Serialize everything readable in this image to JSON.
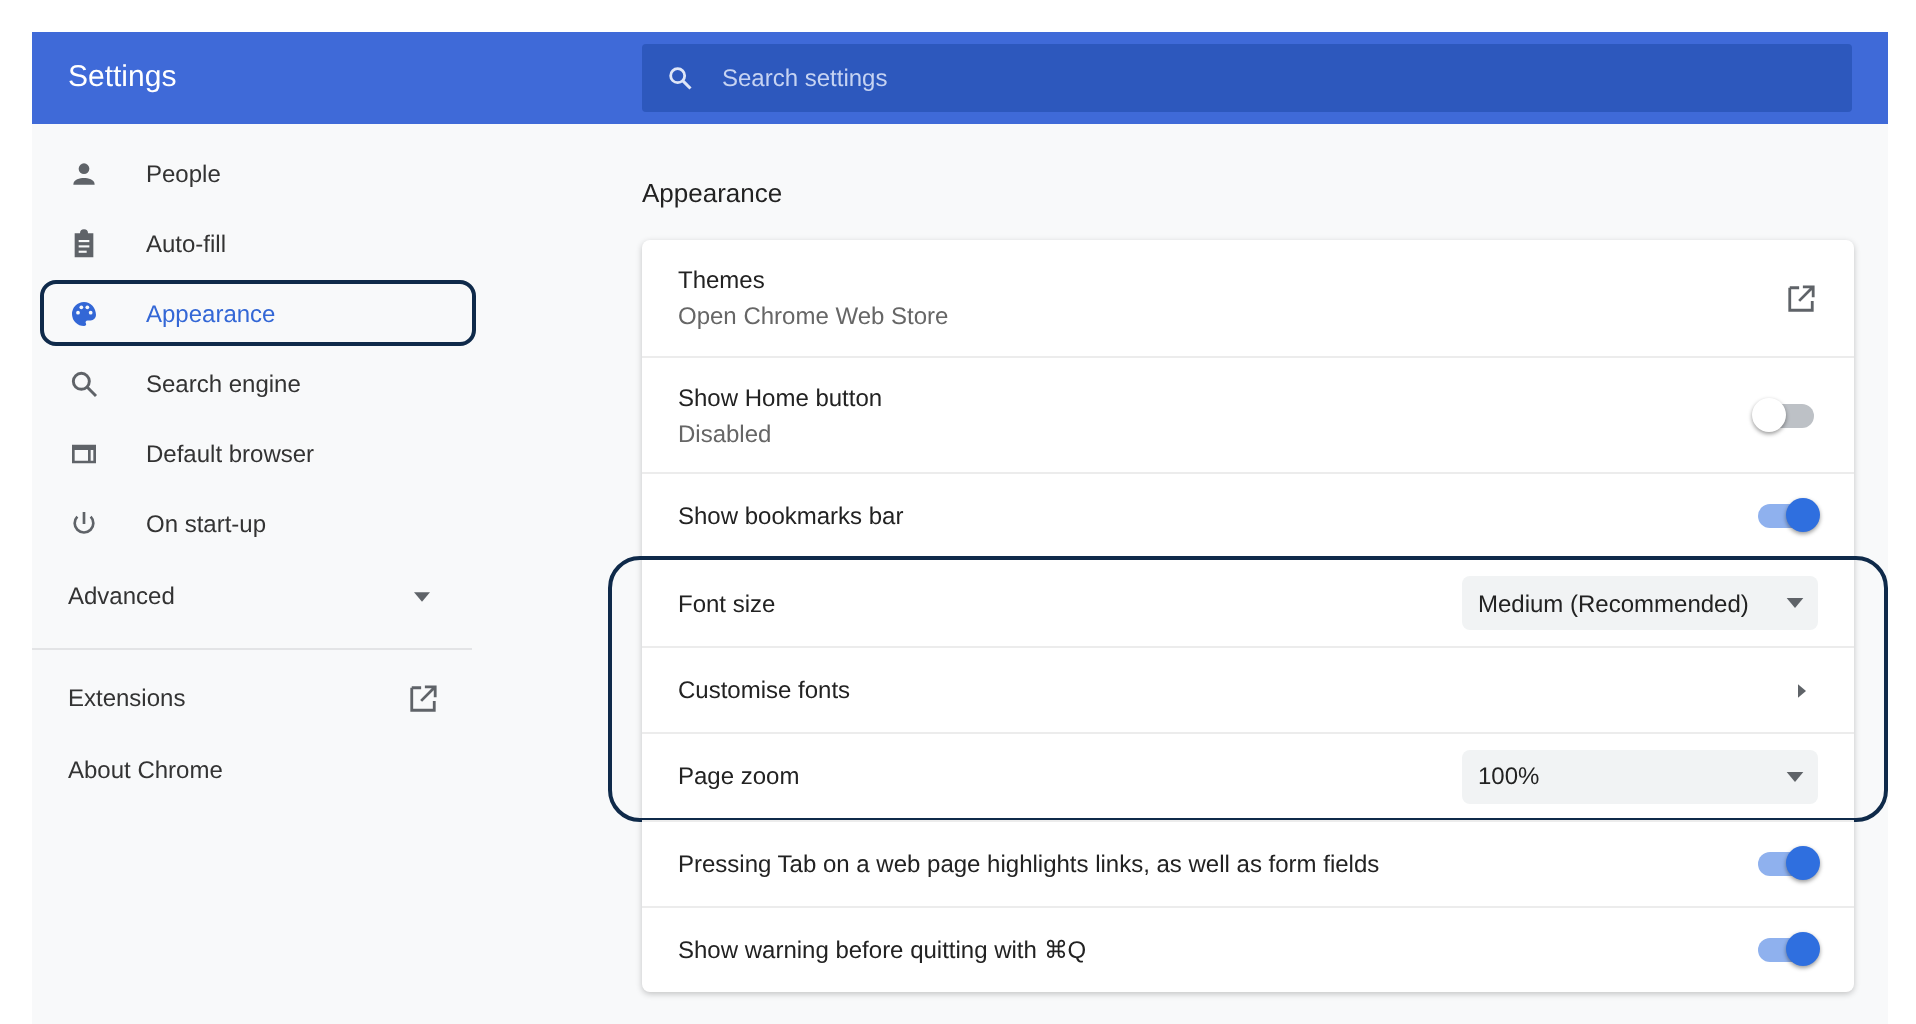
{
  "header": {
    "title": "Settings",
    "search": {
      "placeholder": "Search settings"
    }
  },
  "sidebar": {
    "items": [
      {
        "label": "People",
        "selected": false,
        "highlighted": false
      },
      {
        "label": "Auto-fill",
        "selected": false,
        "highlighted": false
      },
      {
        "label": "Appearance",
        "selected": true,
        "highlighted": true
      },
      {
        "label": "Search engine",
        "selected": false,
        "highlighted": false
      },
      {
        "label": "Default browser",
        "selected": false,
        "highlighted": false
      },
      {
        "label": "On start-up",
        "selected": false,
        "highlighted": false
      }
    ],
    "advanced": {
      "label": "Advanced",
      "expanded": false
    },
    "links": [
      {
        "label": "Extensions",
        "external": true
      },
      {
        "label": "About Chrome",
        "external": false
      }
    ]
  },
  "section": {
    "title": "Appearance",
    "rows": [
      {
        "kind": "link",
        "label": "Themes",
        "sublabel": "Open Chrome Web Store",
        "highlighted": false
      },
      {
        "kind": "toggle",
        "label": "Show Home button",
        "sublabel": "Disabled",
        "on": false,
        "highlighted": false
      },
      {
        "kind": "toggle",
        "label": "Show bookmarks bar",
        "on": true,
        "highlighted": false
      },
      {
        "kind": "select",
        "label": "Font size",
        "value": "Medium (Recommended)",
        "highlighted": true
      },
      {
        "kind": "submenu",
        "label": "Customise fonts",
        "highlighted": true
      },
      {
        "kind": "select",
        "label": "Page zoom",
        "value": "100%",
        "highlighted": true
      },
      {
        "kind": "toggle",
        "label": "Pressing Tab on a web page highlights links, as well as form fields",
        "on": true,
        "highlighted": false
      },
      {
        "kind": "toggle",
        "label": "Show warning before quitting with ⌘Q",
        "on": true,
        "highlighted": false
      }
    ]
  }
}
